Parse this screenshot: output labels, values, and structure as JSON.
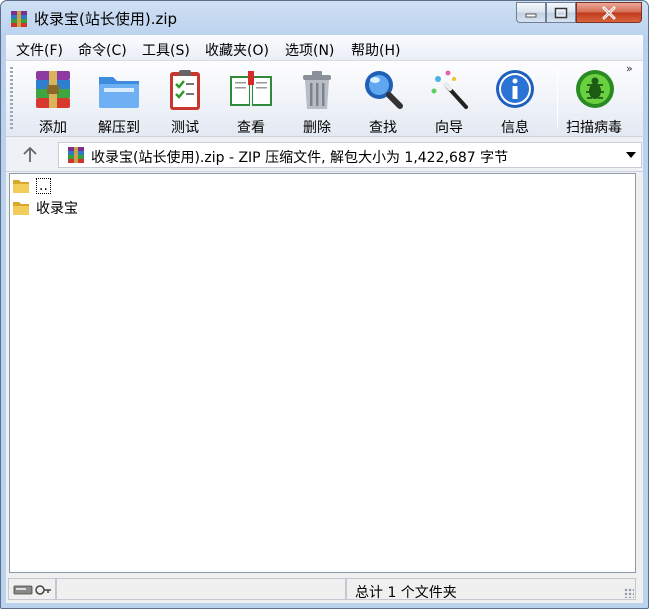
{
  "window": {
    "title": "收录宝(站长使用).zip"
  },
  "menu": [
    "文件(F)",
    "命令(C)",
    "工具(S)",
    "收藏夹(O)",
    "选项(N)",
    "帮助(H)"
  ],
  "toolbar": {
    "buttons": [
      {
        "label": "添加",
        "icon": "add-archive-icon"
      },
      {
        "label": "解压到",
        "icon": "extract-folder-icon"
      },
      {
        "label": "测试",
        "icon": "test-clipboard-icon"
      },
      {
        "label": "查看",
        "icon": "view-book-icon"
      },
      {
        "label": "删除",
        "icon": "trash-can-icon"
      },
      {
        "label": "查找",
        "icon": "magnifier-icon"
      },
      {
        "label": "向导",
        "icon": "wizard-wand-icon"
      },
      {
        "label": "信息",
        "icon": "info-icon"
      },
      {
        "label": "扫描病毒",
        "icon": "virus-scan-icon"
      }
    ],
    "overflow": "»"
  },
  "address": {
    "text": "收录宝(站长使用).zip - ZIP 压缩文件, 解包大小为 1,422,687 字节"
  },
  "files": [
    {
      "name": ".."
    },
    {
      "name": "收录宝"
    }
  ],
  "status": {
    "summary": "总计 1 个文件夹"
  },
  "colors": {
    "title_bg": "#bcd3ee",
    "close_button": "#c0391b",
    "list_bg": "#ffffff"
  }
}
